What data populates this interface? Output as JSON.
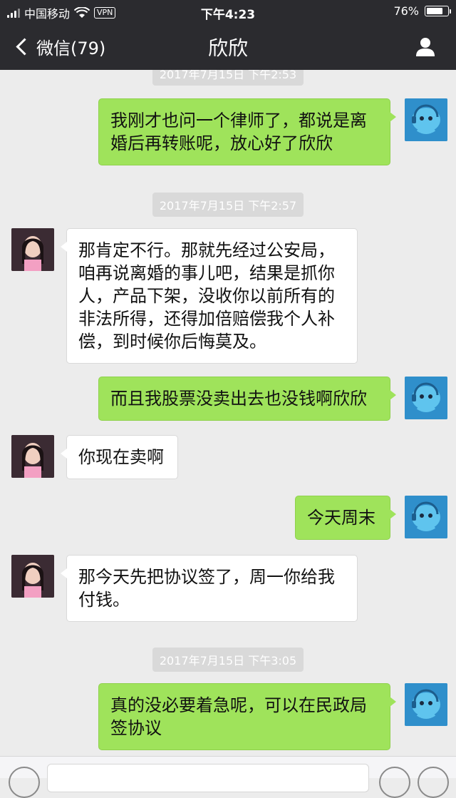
{
  "status": {
    "carrier": "中国移动",
    "vpn": "VPN",
    "time": "下午4:23",
    "battery": "76%",
    "battery_level": 0.76
  },
  "nav": {
    "back_label": "微信(79)",
    "title": "欣欣"
  },
  "timestamps": {
    "t0": "2017年7月15日 下午2:53",
    "t1": "2017年7月15日 下午2:57",
    "t2": "2017年7月15日 下午3:05"
  },
  "messages": {
    "m1": "我刚才也问一个律师了，都说是离婚后再转账呢，放心好了欣欣",
    "m2": "那肯定不行。那就先经过公安局，咱再说离婚的事儿吧，结果是抓你人，产品下架，没收你以前所有的非法所得，还得加倍赔偿我个人补偿，到时候你后悔莫及。",
    "m3": "而且我股票没卖出去也没钱啊欣欣",
    "m4": "你现在卖啊",
    "m5": "今天周末",
    "m6": "那今天先把协议签了，周一你给我付钱。",
    "m7": "真的没必要着急呢，可以在民政局签协议"
  }
}
